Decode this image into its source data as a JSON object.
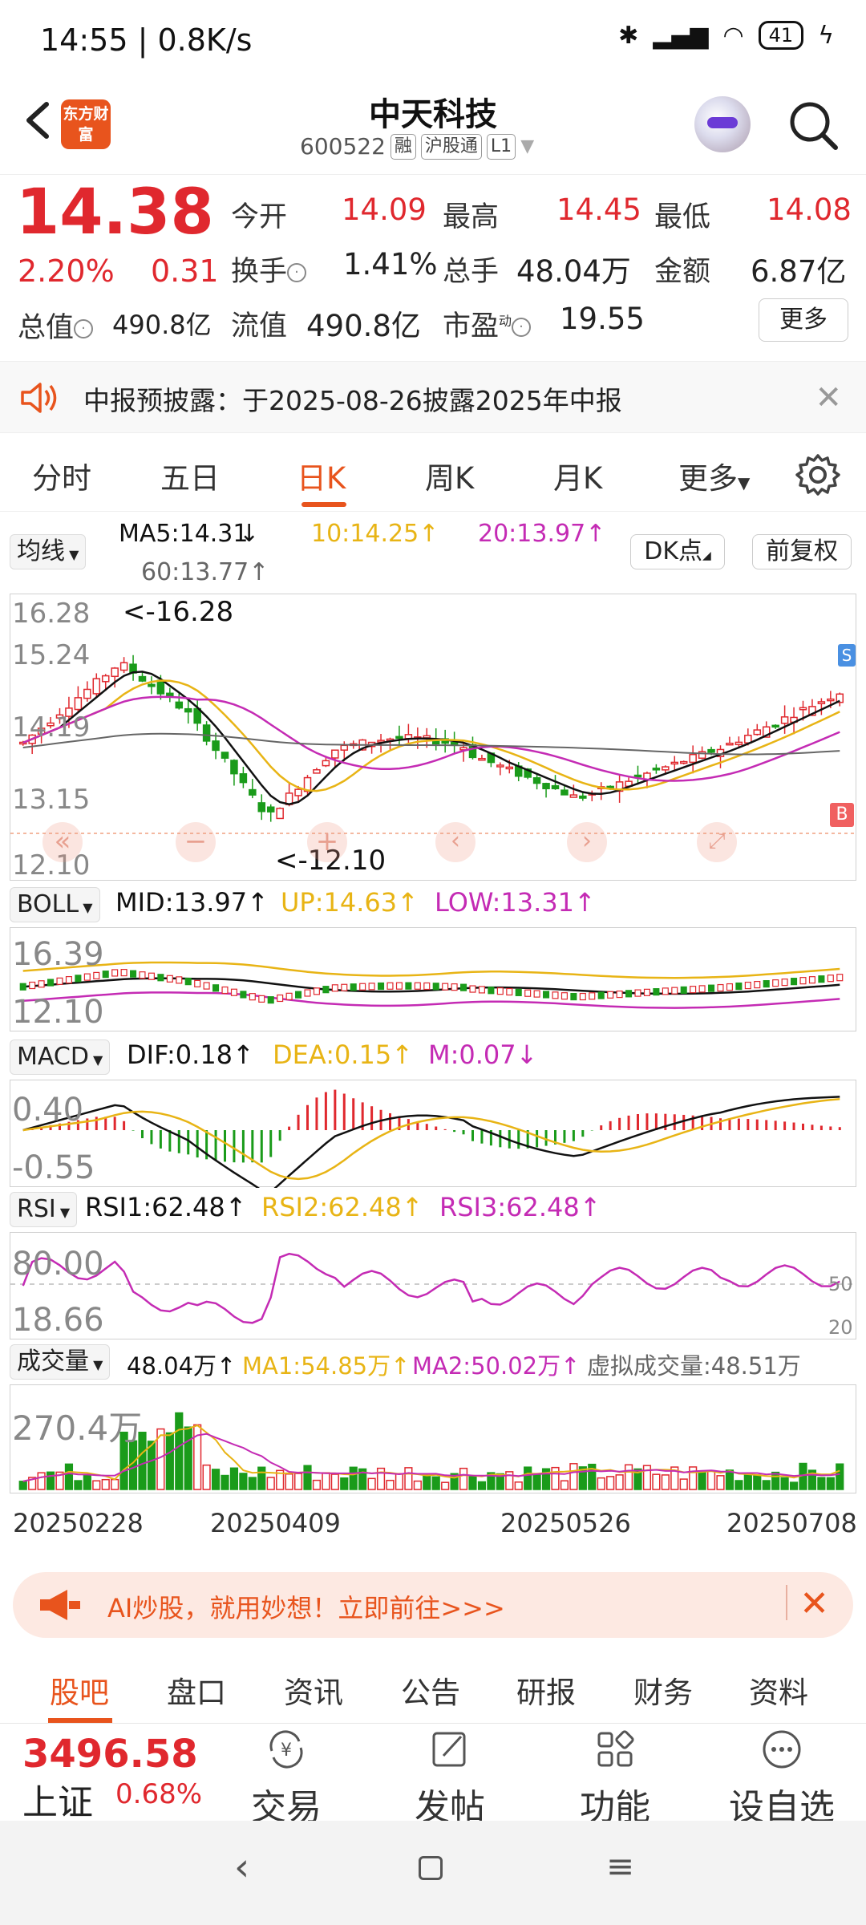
{
  "status_bar": {
    "time": "14:55 | 0.8K/s",
    "battery": "41"
  },
  "header": {
    "app_logo": "东方财富",
    "stock_name": "中天科技",
    "stock_code": "600522",
    "tags": [
      "融",
      "沪股通",
      "L1"
    ]
  },
  "quote": {
    "price": "14.38",
    "change_pct": "2.20%",
    "change": "0.31",
    "rows": [
      [
        {
          "label": "今开",
          "value": "14.09",
          "color": "red"
        },
        {
          "label": "最高",
          "value": "14.45",
          "color": "red"
        },
        {
          "label": "最低",
          "value": "14.08",
          "color": "red"
        }
      ],
      [
        {
          "label": "换手",
          "value": "1.41%",
          "color": "dark"
        },
        {
          "label": "总手",
          "value": "48.04万",
          "color": "dark"
        },
        {
          "label": "金额",
          "value": "6.87亿",
          "color": "dark"
        }
      ]
    ],
    "row3": {
      "total_mv_label": "总值",
      "total_mv": "490.8亿",
      "float_mv_label": "流值",
      "float_mv": "490.8亿",
      "pe_label": "市盈",
      "pe_sup": "动",
      "pe": "19.55",
      "more": "更多"
    }
  },
  "notice": {
    "text": "中报预披露：于2025-08-26披露2025年中报"
  },
  "tabs": [
    "分时",
    "五日",
    "日K",
    "周K",
    "月K",
    "更多"
  ],
  "active_tab": "日K",
  "main_chart": {
    "select": "均线",
    "ma5": "MA5:14.31",
    "ma10": "10:14.25",
    "ma20": "20:13.97",
    "ma60": "60:13.77",
    "dk_button": "DK点",
    "fq_button": "前复权",
    "y_labels": [
      "16.28",
      "15.24",
      "14.19",
      "13.15",
      "12.10"
    ],
    "high_marker": "<-16.28",
    "low_marker": "<-12.10",
    "marker_s": "S",
    "marker_b": "B"
  },
  "boll": {
    "select": "BOLL",
    "mid": "MID:13.97",
    "up": "UP:14.63",
    "low": "LOW:13.31",
    "y_top": "16.39",
    "y_bottom": "12.10"
  },
  "macd": {
    "select": "MACD",
    "dif": "DIF:0.18",
    "dea": "DEA:0.15",
    "m": "M:0.07",
    "y_top": "0.40",
    "y_bottom": "-0.55"
  },
  "rsi": {
    "select": "RSI",
    "rsi1": "RSI1:62.48",
    "rsi2": "RSI2:62.48",
    "rsi3": "RSI3:62.48",
    "y_top": "80.00",
    "y_bottom": "18.66",
    "line_50": "50",
    "line_20": "20"
  },
  "volume": {
    "select": "成交量",
    "vol": "48.04万",
    "ma1": "MA1:54.85万",
    "ma2": "MA2:50.02万",
    "virtual": "虚拟成交量:48.51万",
    "y_top": "270.4万"
  },
  "dates": [
    "20250228",
    "20250409",
    "20250526",
    "20250708"
  ],
  "ai_banner": {
    "text": "AI炒股，就用妙想！立即前往>>>"
  },
  "bottom_tabs": [
    "股吧",
    "盘口",
    "资讯",
    "公告",
    "研报",
    "财务",
    "资料"
  ],
  "index": {
    "value": "3496.58",
    "name": "上证",
    "pct": "0.68%"
  },
  "nav": [
    "交易",
    "发帖",
    "功能",
    "设自选"
  ],
  "colors": {
    "up": "#e0282e",
    "down": "#1a9b1a",
    "accent": "#e8541d",
    "ma10": "#e8b415",
    "ma20": "#c42bb4"
  }
}
